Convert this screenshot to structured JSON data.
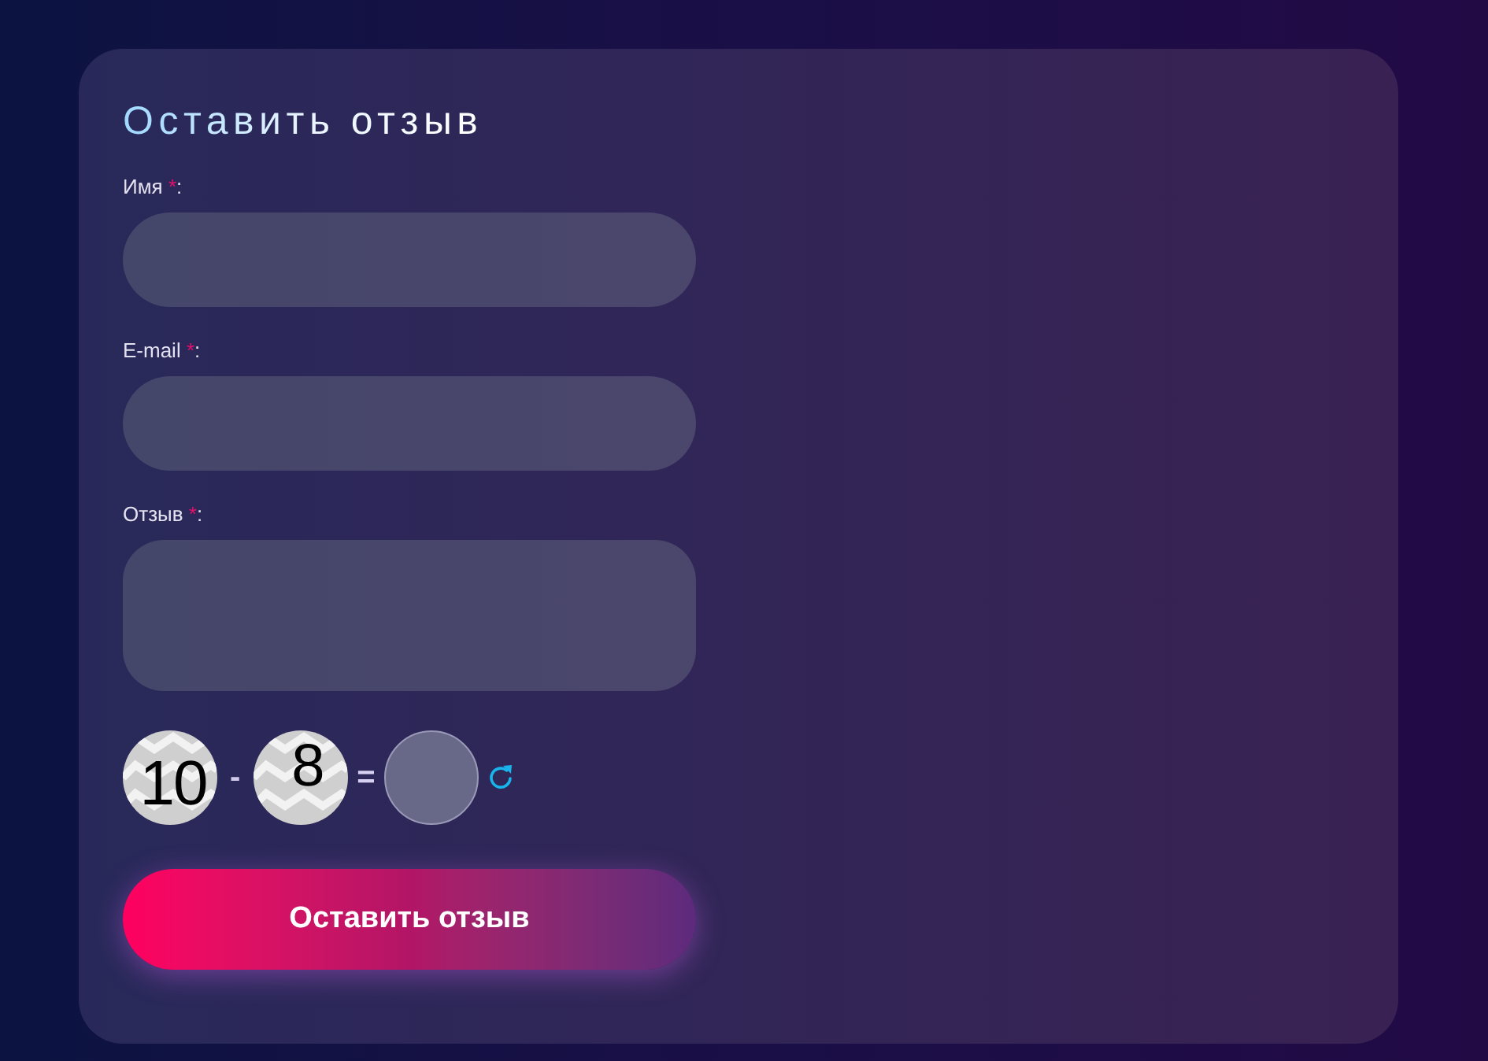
{
  "form": {
    "title": "Оставить отзыв",
    "fields": [
      {
        "kind": "input",
        "label": "Имя",
        "required_mark": "*",
        "label_suffix": ":"
      },
      {
        "kind": "input",
        "label": "E-mail",
        "required_mark": "*",
        "label_suffix": ":"
      },
      {
        "kind": "textarea",
        "label": "Отзыв",
        "required_mark": "*",
        "label_suffix": ":"
      }
    ],
    "captcha": {
      "operand_1": "10",
      "operator": "-",
      "operand_2": "8",
      "equals": "="
    },
    "submit_button": "Оставить отзыв"
  }
}
